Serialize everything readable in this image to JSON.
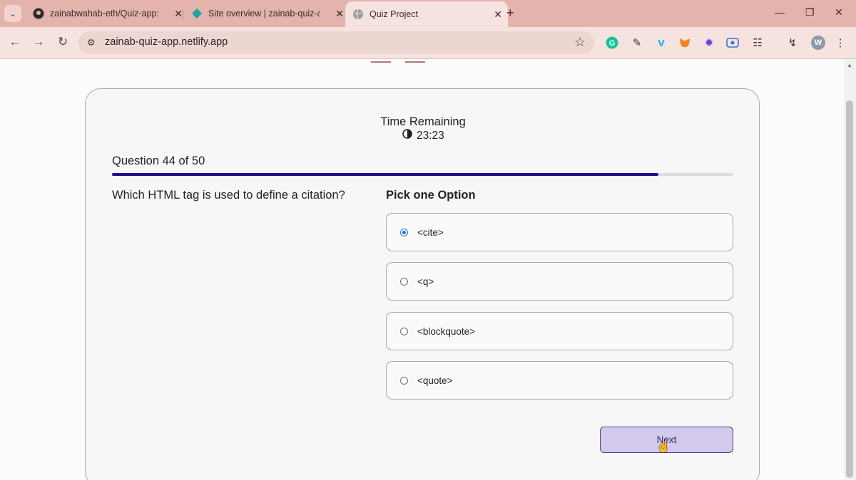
{
  "browser": {
    "tabs": [
      {
        "title": "zainabwahab-eth/Quiz-app: A c",
        "icon": "github-icon",
        "active": false
      },
      {
        "title": "Site overview | zainab-quiz-app",
        "icon": "netlify-icon",
        "active": false
      },
      {
        "title": "Quiz Project",
        "icon": "globe-icon",
        "active": true
      }
    ],
    "new_tab": "+",
    "url": "zainab-quiz-app.netlify.app",
    "profile_initial": "W",
    "accent": "#e4b3ab"
  },
  "quiz": {
    "timer_label": "Time Remaining",
    "timer_value": "23:23",
    "counter": "Question 44 of 50",
    "progress": 0.88,
    "question": "Which HTML tag is used to define a citation?",
    "pick_label": "Pick one Option",
    "options": [
      {
        "label": "<cite>",
        "selected": true
      },
      {
        "label": "<q>",
        "selected": false
      },
      {
        "label": "<blockquote>",
        "selected": false
      },
      {
        "label": "<quote>",
        "selected": false
      }
    ],
    "next_label": "Next",
    "progress_color": "#2b0b8c"
  }
}
